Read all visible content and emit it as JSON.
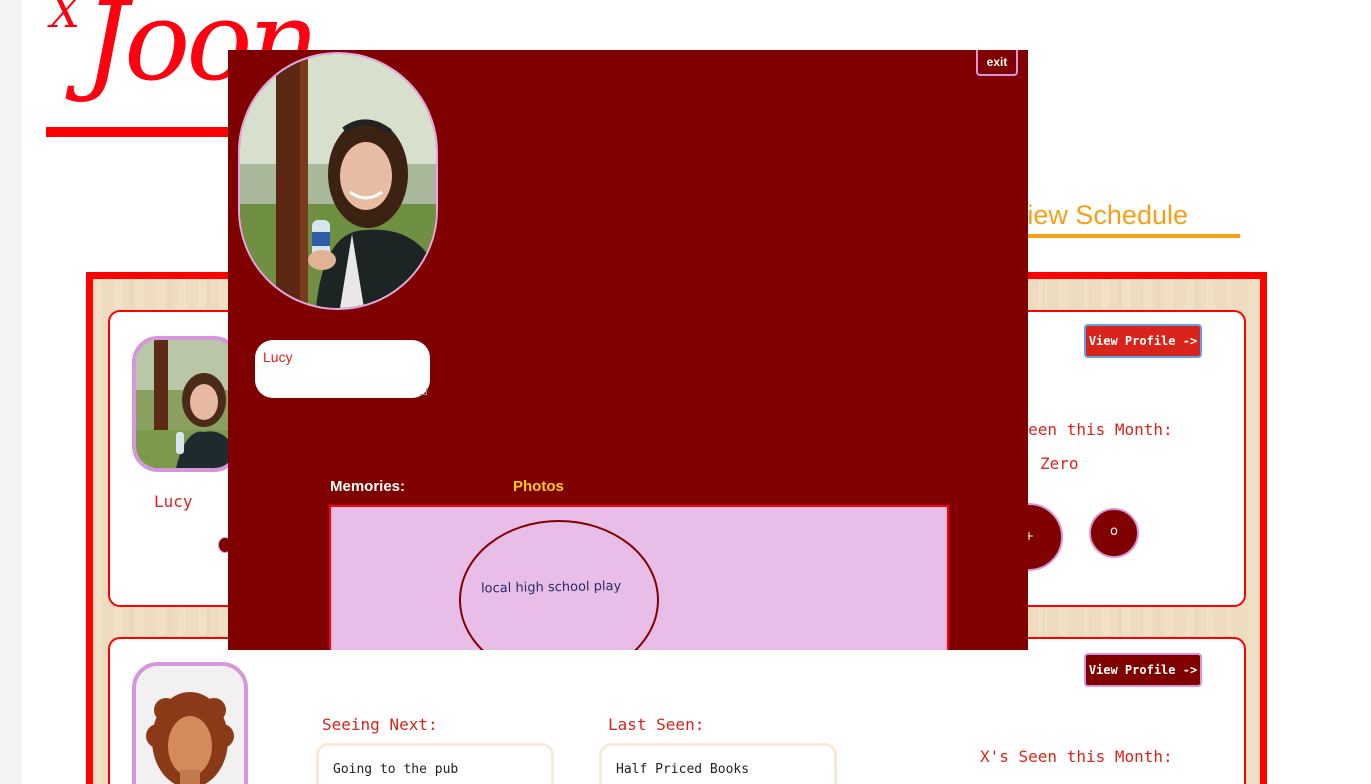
{
  "background": {
    "logo_text": "Joon",
    "logo_mark": "X",
    "nav": {
      "schedule_label": "View Schedule"
    },
    "cards": [
      {
        "name": "Lucy",
        "view_profile_label": "View Profile ->",
        "seen_label": "X's Seen this Month:",
        "seen_value": "Zero",
        "plus_label": "+",
        "minus_label": "o"
      },
      {
        "view_profile_label": "View Profile ->",
        "seeing_next_label": "Seeing Next:",
        "seeing_next_value": "Going to the pub",
        "last_seen_label": "Last Seen:",
        "last_seen_value": "Half Priced Books",
        "seen_label": "X's Seen this Month:"
      }
    ]
  },
  "modal": {
    "exit_label": "exit",
    "name_value": "Lucy",
    "memories_label": "Memories:",
    "photos_tab_label": "Photos",
    "memories": [
      {
        "text": "local high school play"
      }
    ]
  },
  "colors": {
    "brand_red": "#ff0000",
    "modal_bg": "#800000",
    "accent_orange": "#f5a018",
    "accent_yellow": "#ffcc16",
    "panel_pink": "#e8bde8",
    "border_pink": "#d596dc"
  },
  "icons": {
    "profile_photo": "person-photo",
    "default_avatar": "person-avatar-icon"
  }
}
